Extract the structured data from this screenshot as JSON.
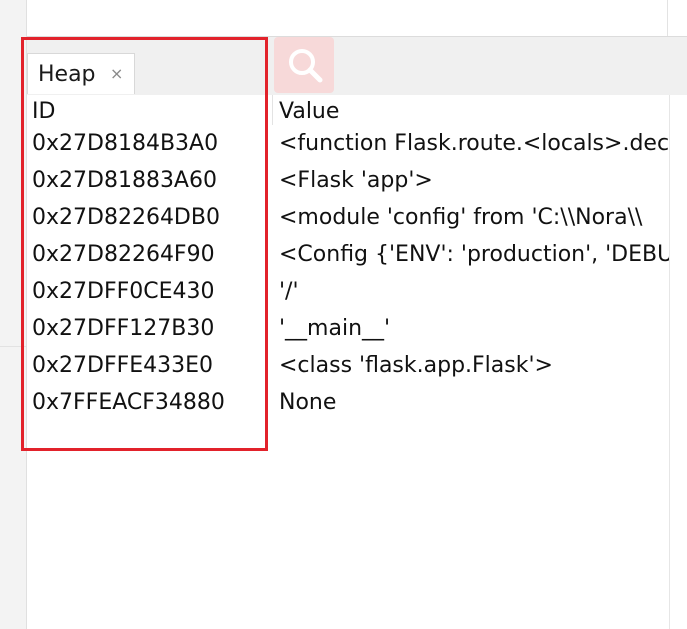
{
  "tab": {
    "label": "Heap",
    "close_glyph": "×"
  },
  "icons": {
    "search": "search-icon",
    "close": "close-icon"
  },
  "colors": {
    "highlight": "#e2222b",
    "search_button_bg": "#f7d9d9"
  },
  "table": {
    "columns": [
      "ID",
      "Value"
    ],
    "rows": [
      {
        "id": "0x27D8184B3A0",
        "value": "<function Flask.route.<locals>.dec"
      },
      {
        "id": "0x27D81883A60",
        "value": "<Flask 'app'>"
      },
      {
        "id": "0x27D82264DB0",
        "value": "<module 'config' from 'C:\\\\Nora\\\\"
      },
      {
        "id": "0x27D82264F90",
        "value": "<Config {'ENV': 'production', 'DEBU"
      },
      {
        "id": "0x27DFF0CE430",
        "value": "'/'"
      },
      {
        "id": "0x27DFF127B30",
        "value": "'__main__'"
      },
      {
        "id": "0x27DFFE433E0",
        "value": "<class 'flask.app.Flask'>"
      },
      {
        "id": "0x7FFEACF34880",
        "value": "None"
      }
    ]
  }
}
